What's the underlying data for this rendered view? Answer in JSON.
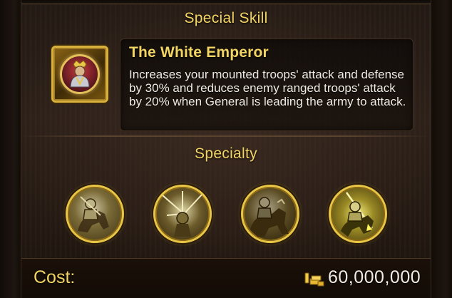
{
  "skill_section": {
    "title": "Special Skill",
    "skill_name": "The White Emperor",
    "description": "Increases your mounted troops' attack and defense by 30% and reduces enemy ranged troops' attack by 20% when General is leading the army to attack.",
    "icon": "emperor-portrait-icon"
  },
  "specialty_section": {
    "title": "Specialty",
    "badges": [
      {
        "icon": "mounted-knight-icon"
      },
      {
        "icon": "archer-volley-icon"
      },
      {
        "icon": "cavalry-charge-icon"
      },
      {
        "icon": "lancer-attack-icon"
      }
    ]
  },
  "footer": {
    "cost_label": "Cost:",
    "cost_icon": "gold-resource-icon",
    "cost_value": "60,000,000"
  },
  "colors": {
    "gold_text": "#f3d564",
    "body_text": "#f1ece4",
    "frame_gold": "#e8c546",
    "background": "#241a14"
  }
}
